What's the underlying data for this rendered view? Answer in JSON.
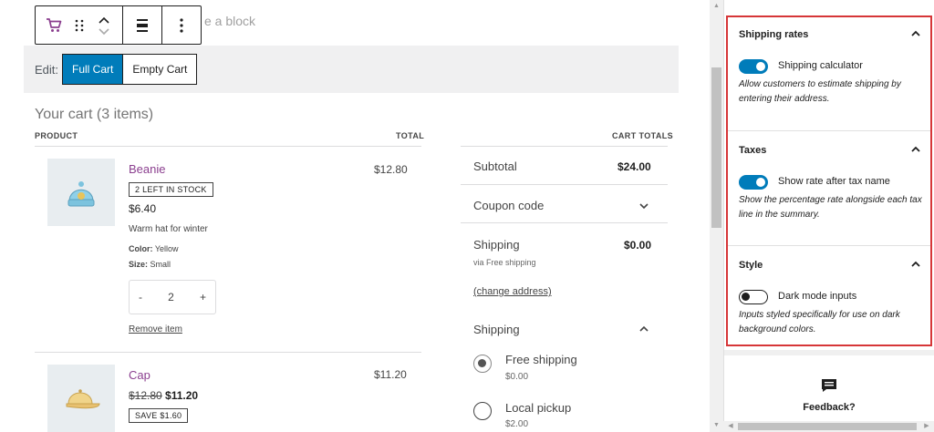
{
  "editor": {
    "placeholder_text": "e a block",
    "edit_label": "Edit:",
    "view_buttons": [
      {
        "label": "Full Cart",
        "active": true
      },
      {
        "label": "Empty Cart",
        "active": false
      }
    ]
  },
  "cart": {
    "title": "Your cart (3 items)",
    "col_product": "PRODUCT",
    "col_total": "TOTAL",
    "items": [
      {
        "name": "Beanie",
        "badge": "2 LEFT IN STOCK",
        "price": "$6.40",
        "description": "Warm hat for winter",
        "meta": [
          {
            "key": "Color:",
            "value": "Yellow"
          },
          {
            "key": "Size:",
            "value": "Small"
          }
        ],
        "qty_minus": "-",
        "quantity": "2",
        "qty_plus": "+",
        "remove_label": "Remove item",
        "line_total": "$12.80"
      },
      {
        "name": "Cap",
        "old_price": "$12.80",
        "new_price": "$11.20",
        "badge": "SAVE $1.60",
        "line_total": "$11.20"
      }
    ]
  },
  "totals": {
    "heading": "CART TOTALS",
    "subtotal_label": "Subtotal",
    "subtotal_value": "$24.00",
    "coupon_label": "Coupon code",
    "shipping_label": "Shipping",
    "shipping_value": "$0.00",
    "shipping_via": "via Free shipping",
    "change_address": "(change address)",
    "shipping_section_label": "Shipping",
    "options": [
      {
        "label": "Free shipping",
        "price": "$0.00",
        "checked": true
      },
      {
        "label": "Local pickup",
        "price": "$2.00",
        "checked": false
      }
    ]
  },
  "sidebar": {
    "panels": [
      {
        "title": "Shipping rates",
        "toggle_label": "Shipping calculator",
        "toggle_on": true,
        "help": "Allow customers to estimate shipping by entering their address."
      },
      {
        "title": "Taxes",
        "toggle_label": "Show rate after tax name",
        "toggle_on": true,
        "help": "Show the percentage rate alongside each tax line in the summary."
      },
      {
        "title": "Style",
        "toggle_label": "Dark mode inputs",
        "toggle_on": false,
        "help": "Inputs styled specifically for use on dark background colors."
      }
    ],
    "feedback_label": "Feedback?"
  },
  "colors": {
    "accent": "#007cba",
    "highlight_border": "#d63638",
    "product_link": "#8b3f8f"
  }
}
